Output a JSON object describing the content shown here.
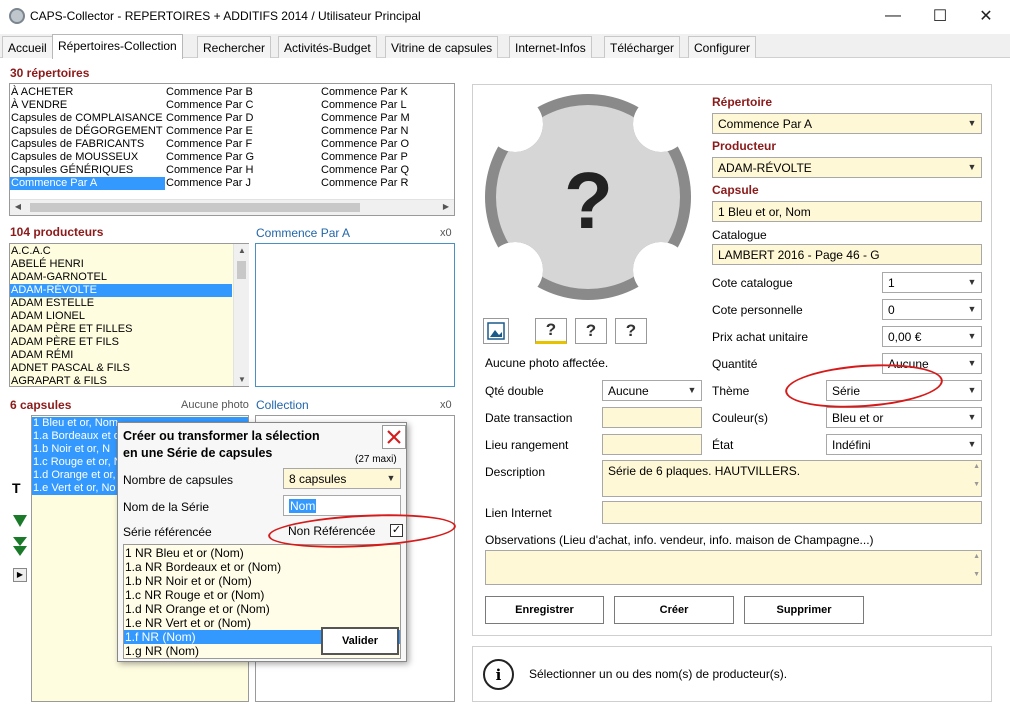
{
  "window": {
    "title": "CAPS-Collector - REPERTOIRES + ADDITIFS 2014 / Utilisateur Principal",
    "minimize": "—",
    "maximize": "☐",
    "close": "✕"
  },
  "tabs": [
    {
      "label": "Accueil"
    },
    {
      "label": "Répertoires-Collection"
    },
    {
      "label": "Rechercher"
    },
    {
      "label": "Activités-Budget"
    },
    {
      "label": "Vitrine de capsules"
    },
    {
      "label": "Internet-Infos"
    },
    {
      "label": "Télécharger"
    },
    {
      "label": "Configurer"
    }
  ],
  "repertoires": {
    "heading": "30 répertoires",
    "col1": [
      "À ACHETER",
      "À VENDRE",
      "Capsules de COMPLAISANCE",
      "Capsules de DÉGORGEMENT",
      "Capsules de FABRICANTS",
      "Capsules de MOUSSEUX",
      "Capsules GÉNÉRIQUES",
      "Commence Par A"
    ],
    "col2": [
      "Commence Par B",
      "Commence Par C",
      "Commence Par D",
      "Commence Par E",
      "Commence Par F",
      "Commence Par G",
      "Commence Par H",
      "Commence Par J"
    ],
    "col3": [
      "Commence Par K",
      "Commence Par L",
      "Commence Par M",
      "Commence Par N",
      "Commence Par O",
      "Commence Par P",
      "Commence Par Q",
      "Commence Par R"
    ],
    "selected": "Commence Par A"
  },
  "producteurs": {
    "heading": "104 producteurs",
    "items": [
      "A.C.A.C",
      "ABELÉ HENRI",
      "ADAM-GARNOTEL",
      "ADAM-RÉVOLTE",
      "ADAM ESTELLE",
      "ADAM LIONEL",
      "ADAM PÈRE ET FILLES",
      "ADAM PÈRE ET FILS",
      "ADAM RÉMI",
      "ADNET PASCAL & FILS",
      "AGRAPART & FILS"
    ],
    "selected": "ADAM-RÉVOLTE",
    "right_heading": "Commence Par A",
    "right_count": "x0"
  },
  "capsules": {
    "heading": "6 capsules",
    "photo_label": "Aucune photo",
    "items": [
      "1 Bleu et or, Nom",
      "1.a Bordeaux et o",
      "1.b Noir et or, N",
      "1.c Rouge et or, N",
      "1.d Orange et or,",
      "1.e Vert et or, No"
    ],
    "side_t": "T",
    "collection_heading": "Collection",
    "collection_count": "x0"
  },
  "dialog": {
    "title_line1": "Créer ou transformer la sélection",
    "title_line2": "en une Série de capsules",
    "max": "(27 maxi)",
    "nombre_label": "Nombre de capsules",
    "nombre_value": "8 capsules",
    "nom_label": "Nom de la Série",
    "nom_value": "Nom",
    "serie_ref_label": "Série référencée",
    "non_ref_label": "Non Référencée",
    "list": [
      "1 NR Bleu et or (Nom)",
      "1.a NR Bordeaux et or (Nom)",
      "1.b NR Noir et or (Nom)",
      "1.c NR Rouge et or (Nom)",
      "1.d NR Orange et or (Nom)",
      "1.e NR Vert et or (Nom)",
      "1.f NR (Nom)",
      "1.g NR (Nom)"
    ],
    "selected": "1.f NR (Nom)",
    "valider": "Valider"
  },
  "detail": {
    "photo_placeholder": "?",
    "photo_status": "Aucune photo affectée.",
    "repertoire_label": "Répertoire",
    "repertoire_value": "Commence Par A",
    "producteur_label": "Producteur",
    "producteur_value": "ADAM-RÉVOLTE",
    "capsule_label": "Capsule",
    "capsule_value": "1 Bleu et or, Nom",
    "catalogue_label": "Catalogue",
    "catalogue_value": "LAMBERT 2016 - Page 46 - G",
    "cote_cat_label": "Cote catalogue",
    "cote_cat_value": "1",
    "cote_perso_label": "Cote personnelle",
    "cote_perso_value": "0",
    "prix_label": "Prix achat unitaire",
    "prix_value": "0,00 €",
    "quantite_label": "Quantité",
    "quantite_value": "Aucune",
    "qte_double_label": "Qté double",
    "qte_double_value": "Aucune",
    "theme_label": "Thème",
    "theme_value": "Série",
    "date_label": "Date transaction",
    "couleur_label": "Couleur(s)",
    "couleur_value": "Bleu et or",
    "lieu_label": "Lieu rangement",
    "etat_label": "État",
    "etat_value": "Indéfini",
    "description_label": "Description",
    "description_value": "Série de 6 plaques. HAUTVILLERS.",
    "lien_label": "Lien Internet",
    "observations_label": "Observations (Lieu d'achat, info. vendeur, info. maison de Champagne...)",
    "btn_enregistrer": "Enregistrer",
    "btn_creer": "Créer",
    "btn_supprimer": "Supprimer"
  },
  "info_bar": {
    "message": "Sélectionner un ou des nom(s) de producteur(s).",
    "icon": "i"
  },
  "colors": {
    "accent": "#8b1a1a",
    "selection": "#3399ff",
    "field_yellow": "#fff8d6",
    "highlight_ring": "#d61a1a"
  }
}
